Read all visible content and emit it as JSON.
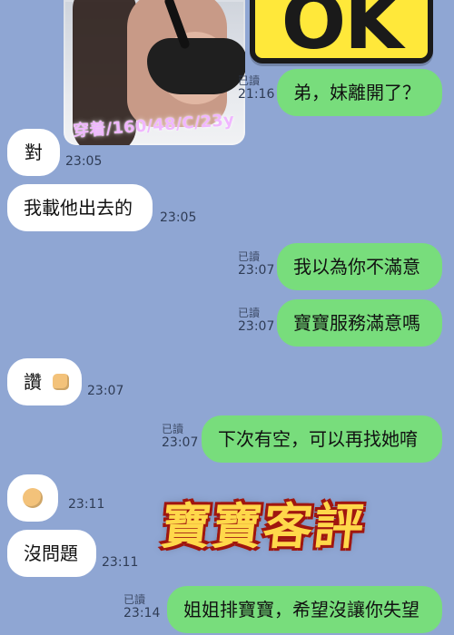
{
  "header": {
    "photo_watermark": "穿着/160/48/C/23y",
    "sticker_top_right": "OK"
  },
  "messages": [
    {
      "id": "m1",
      "side": "outgoing",
      "text": "弟，妹離開了？",
      "read_label": "已讀",
      "time": "21:16"
    },
    {
      "id": "m2",
      "side": "incoming",
      "text": "對",
      "time": "23:05"
    },
    {
      "id": "m3",
      "side": "incoming",
      "text": "我載他出去的",
      "time": "23:05"
    },
    {
      "id": "m4",
      "side": "outgoing",
      "text": "我以為你不滿意",
      "read_label": "已讀",
      "time": "23:07"
    },
    {
      "id": "m5",
      "side": "outgoing",
      "text": "寶寶服務滿意嗎",
      "read_label": "已讀",
      "time": "23:07"
    },
    {
      "id": "m6",
      "side": "incoming",
      "text": "讚",
      "emoji": "thumbs-up",
      "time": "23:07"
    },
    {
      "id": "m7",
      "side": "outgoing",
      "text": "下次有空，可以再找她唷",
      "read_label": "已讀",
      "time": "23:07"
    },
    {
      "id": "m8",
      "side": "incoming",
      "text": "",
      "emoji": "ok-hand",
      "time": "23:11"
    },
    {
      "id": "m9",
      "side": "incoming",
      "text": "沒問題",
      "time": "23:11"
    },
    {
      "id": "m10",
      "side": "outgoing",
      "text": "姐姐排寶寶，希望沒讓你失望",
      "read_label": "已讀",
      "time": "23:14"
    }
  ],
  "stickers": {
    "center_text": "寶寶客評"
  },
  "colors": {
    "background": "#8fa6d3",
    "incoming_bubble": "#ffffff",
    "outgoing_bubble": "#78dd7c"
  },
  "icons": {
    "thumbs_up": "thumbs-up-icon",
    "ok_hand": "ok-hand-icon"
  }
}
